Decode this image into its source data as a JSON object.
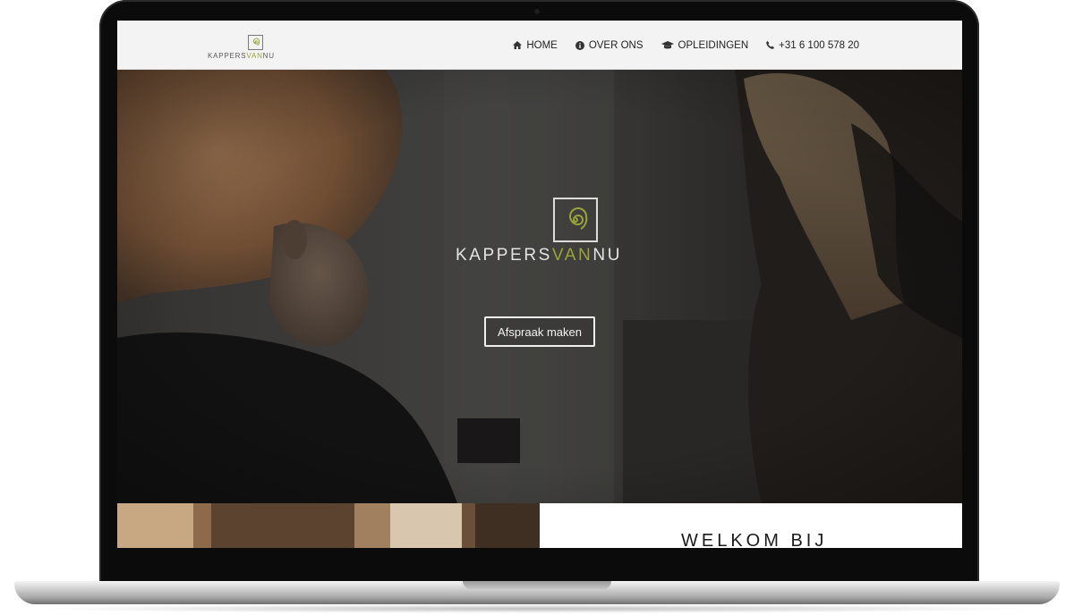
{
  "brand": {
    "prefix": "KAPPERS",
    "accent": "VAN",
    "suffix": "NU",
    "accent_color": "#9aa33a"
  },
  "nav": {
    "items": [
      {
        "label": "HOME",
        "icon": "home-icon"
      },
      {
        "label": "OVER ONS",
        "icon": "info-icon"
      },
      {
        "label": "OPLEIDINGEN",
        "icon": "graduation-cap-icon"
      },
      {
        "label": "+31 6 100 578 20",
        "icon": "phone-icon"
      }
    ]
  },
  "hero": {
    "cta_label": "Afspraak maken"
  },
  "welcome": {
    "title": "WELKOM BIJ"
  }
}
